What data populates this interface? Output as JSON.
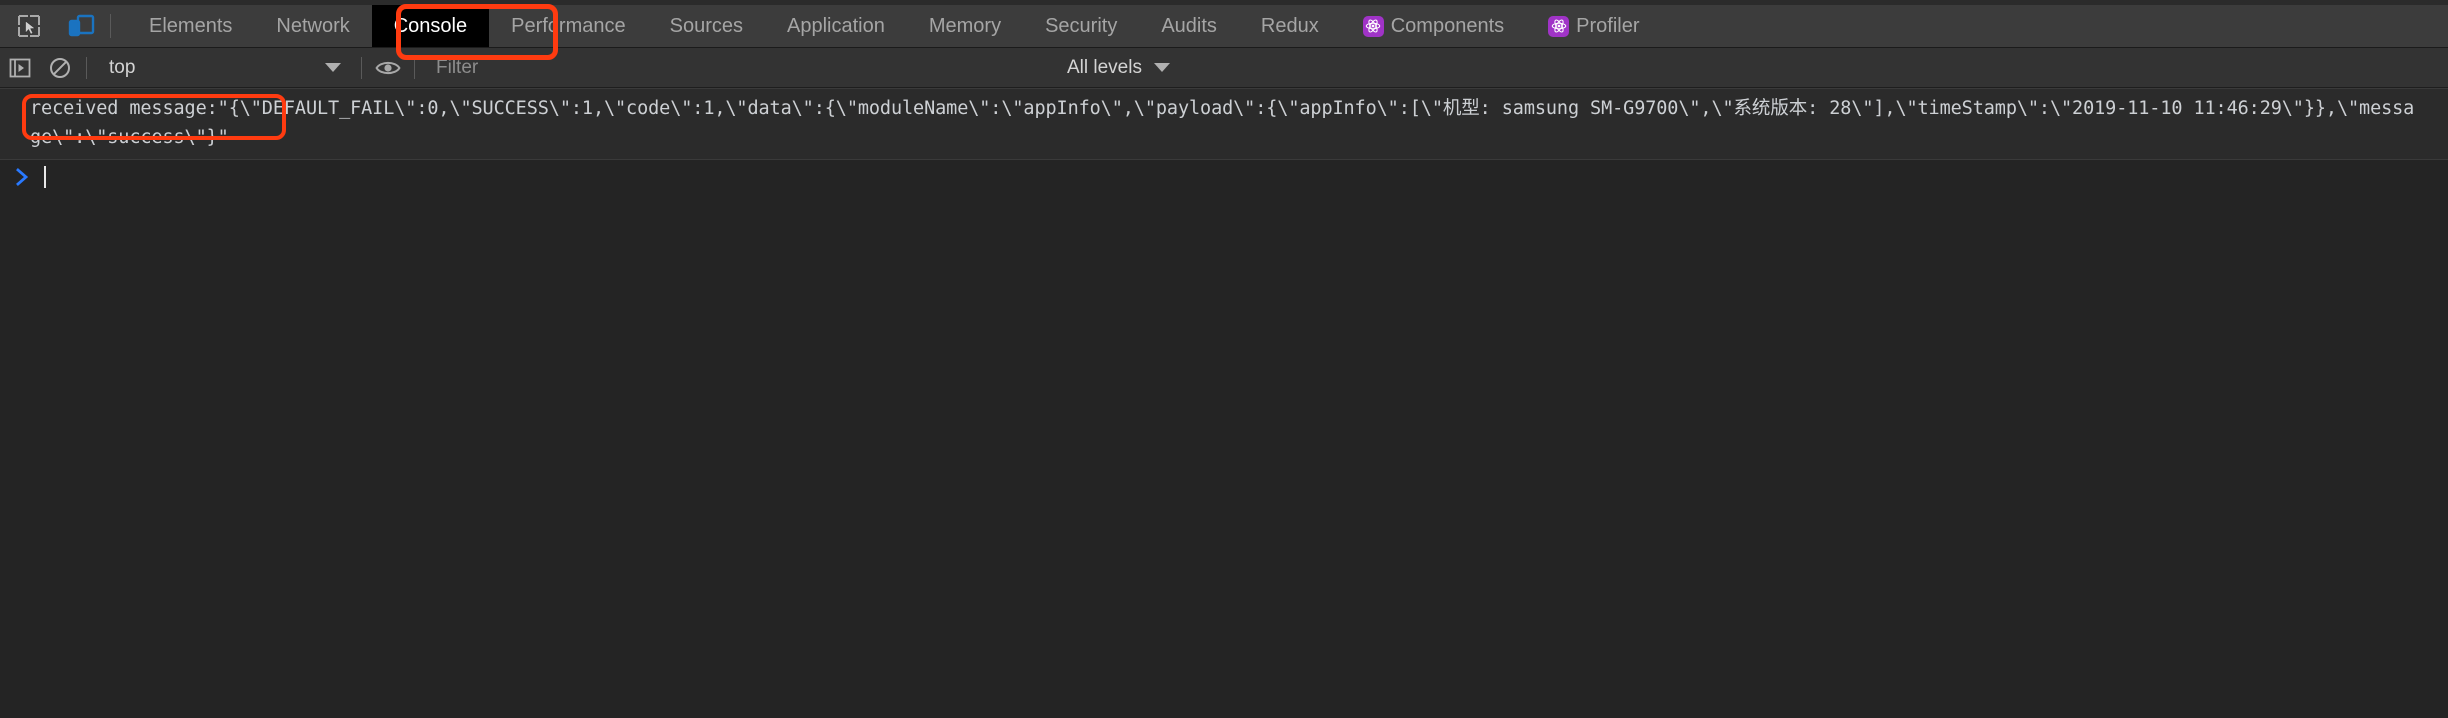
{
  "window": {
    "app": "Chrome DevTools",
    "active_panel": "Console"
  },
  "toolbar": {
    "icons": [
      {
        "name": "inspect-element-icon",
        "title": "Inspect element",
        "active": false
      },
      {
        "name": "device-toolbar-icon",
        "title": "Toggle device toolbar",
        "active": true
      }
    ],
    "tabs": [
      {
        "label": "Elements",
        "active": false,
        "icon": null
      },
      {
        "label": "Network",
        "active": false,
        "icon": null
      },
      {
        "label": "Console",
        "active": true,
        "icon": null
      },
      {
        "label": "Performance",
        "active": false,
        "icon": null
      },
      {
        "label": "Sources",
        "active": false,
        "icon": null
      },
      {
        "label": "Application",
        "active": false,
        "icon": null
      },
      {
        "label": "Memory",
        "active": false,
        "icon": null
      },
      {
        "label": "Security",
        "active": false,
        "icon": null
      },
      {
        "label": "Audits",
        "active": false,
        "icon": null
      },
      {
        "label": "Redux",
        "active": false,
        "icon": null
      },
      {
        "label": "Components",
        "active": false,
        "icon": "react-icon"
      },
      {
        "label": "Profiler",
        "active": false,
        "icon": "react-icon"
      }
    ]
  },
  "console_toolbar": {
    "execute_icon": "execute-sidebar-icon",
    "clear_icon": "clear-console-icon",
    "context_value": "top",
    "eye_icon": "live-expression-eye-icon",
    "filter_placeholder": "Filter",
    "filter_value": "",
    "levels_value": "All levels"
  },
  "console": {
    "messages": [
      {
        "label": "received message:\"",
        "annotated": true,
        "body": "{\\\"DEFAULT_FAIL\\\":0,\\\"SUCCESS\\\":1,\\\"code\\\":1,\\\"data\\\":{\\\"moduleName\\\":\\\"appInfo\\\",\\\"payload\\\":{\\\"appInfo\\\":[\\\"机型: samsung SM-G9700\\\",\\\"系统版本: 28\\\"],\\\"timeStamp\\\":\\\"2019-11-10 11:46:29\\\"}},\\\"message\\\":\\\"success\\\"}\""
      }
    ],
    "prompt_symbol": ">",
    "prompt_value": ""
  },
  "colors": {
    "annotation": "#ff3b10",
    "tab_active_bg": "#000000",
    "toolbar_bg": "#3c3c3c",
    "console_bg": "#242424",
    "message_bg": "#2b2b2b",
    "react_badge": "#a033c7",
    "prompt_blue": "#2979ff",
    "device_icon_blue": "#1a73c0"
  }
}
